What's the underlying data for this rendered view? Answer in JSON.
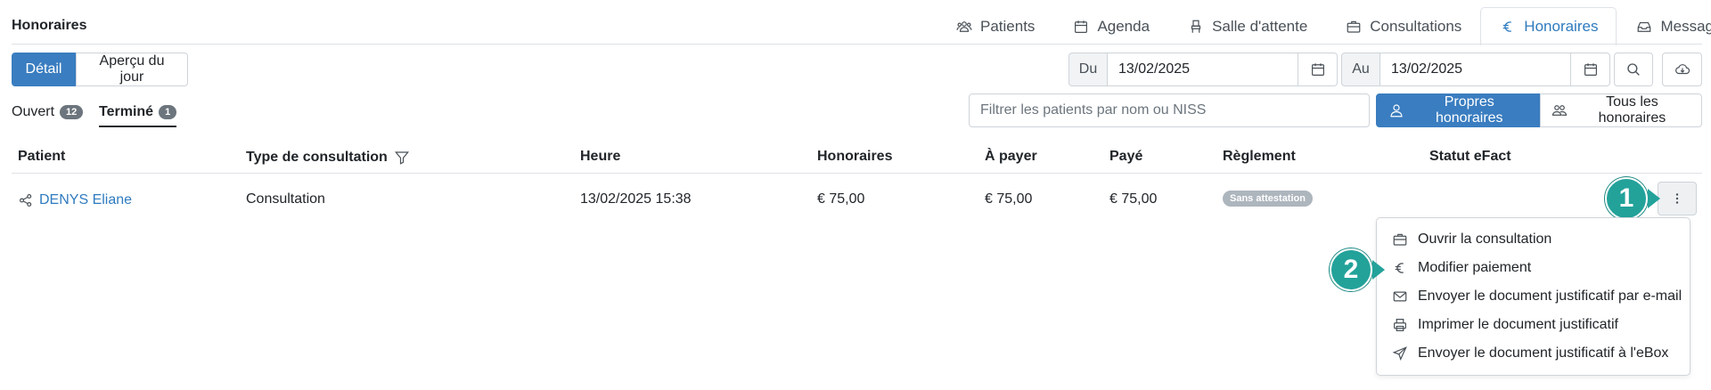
{
  "page_title": "Honoraires",
  "nav": [
    {
      "label": "Patients",
      "icon": "users-icon"
    },
    {
      "label": "Agenda",
      "icon": "calendar-icon"
    },
    {
      "label": "Salle d'attente",
      "icon": "chair-icon"
    },
    {
      "label": "Consultations",
      "icon": "briefcase-icon"
    },
    {
      "label": "Honoraires",
      "icon": "euro-icon",
      "active": true
    },
    {
      "label": "Messages",
      "icon": "inbox-icon"
    }
  ],
  "view_buttons": {
    "detail": "Détail",
    "apercu": "Aperçu du jour"
  },
  "date_from": {
    "label": "Du",
    "value": "13/02/2025"
  },
  "date_to": {
    "label": "Au",
    "value": "13/02/2025"
  },
  "subtabs": {
    "open": {
      "label": "Ouvert",
      "count": "12"
    },
    "done": {
      "label": "Terminé",
      "count": "1"
    }
  },
  "filter": {
    "placeholder": "Filtrer les patients par nom ou NISS"
  },
  "scope_buttons": {
    "own": "Propres honoraires",
    "all": "Tous les honoraires"
  },
  "table": {
    "headers": [
      "Patient",
      "Type de consultation",
      "Heure",
      "Honoraires",
      "À payer",
      "Payé",
      "Règlement",
      "Statut eFact"
    ],
    "rows": [
      {
        "patient": "DENYS Eliane",
        "type": "Consultation",
        "heure": "13/02/2025 15:38",
        "honoraires": "€ 75,00",
        "a_payer": "€ 75,00",
        "paye": "€ 75,00",
        "reglement": "Sans attestation",
        "statut": ""
      }
    ]
  },
  "menu": [
    {
      "label": "Ouvrir la consultation",
      "icon": "briefcase-icon"
    },
    {
      "label": "Modifier paiement",
      "icon": "euro-icon"
    },
    {
      "label": "Envoyer le document justificatif par e-mail",
      "icon": "envelope-icon"
    },
    {
      "label": "Imprimer le document justificatif",
      "icon": "printer-icon"
    },
    {
      "label": "Envoyer le document justificatif à l'eBox",
      "icon": "send-icon"
    }
  ],
  "callouts": [
    "1",
    "2"
  ],
  "colors": {
    "primary": "#3a7dc0",
    "link": "#2f7bbf",
    "callout": "#23a29a",
    "pill": "#adb5bd"
  }
}
